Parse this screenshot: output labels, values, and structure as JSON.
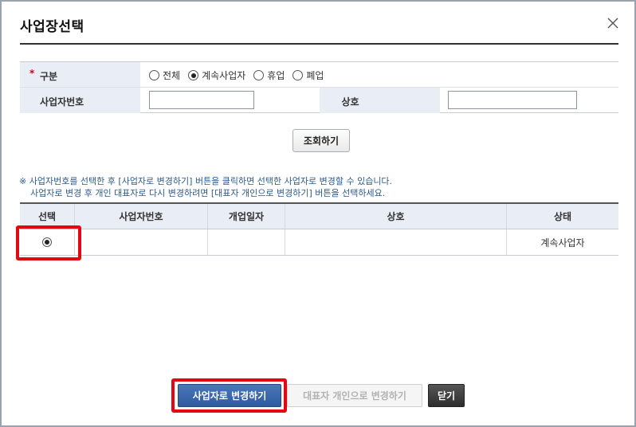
{
  "dialog": {
    "title": "사업장선택",
    "close_icon": "close-icon"
  },
  "form": {
    "required_mark": "*",
    "type_label": "구분",
    "type_options": [
      "전체",
      "계속사업자",
      "휴업",
      "폐업"
    ],
    "type_selected": "계속사업자",
    "bizno_label": "사업자번호",
    "bizno_value": "",
    "name_label": "상호",
    "name_value": "",
    "search_button": "조회하기"
  },
  "notice": {
    "line1": "※ 사업자번호를 선택한 후 [사업자로 변경하기] 버튼을 클릭하면 선택한 사업자로 변경할 수 있습니다.",
    "line2": "사업자로 변경 후 개인 대표자로 다시 변경하려면 [대표자 개인으로 변경하기] 버튼을 선택하세요."
  },
  "table": {
    "headers": [
      "선택",
      "사업자번호",
      "개업일자",
      "상호",
      "상태"
    ],
    "rows": [
      {
        "selected": true,
        "bizno": "",
        "open_date": "",
        "name": "",
        "status": "계속사업자"
      }
    ]
  },
  "buttons": {
    "change_to_business": "사업자로 변경하기",
    "change_to_representative": "대표자 개인으로 변경하기",
    "close": "닫기"
  },
  "colors": {
    "highlight": "#e30613",
    "primary": "#2f5c9e",
    "header_bg": "#e9edf5"
  }
}
